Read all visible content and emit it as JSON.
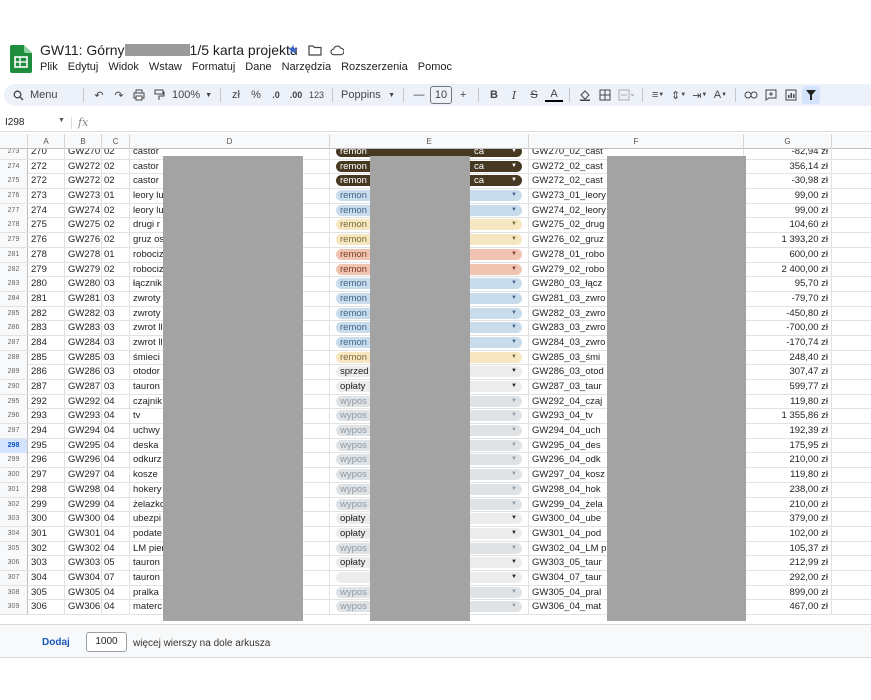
{
  "title": {
    "prefix": "GW11: Górny",
    "suffix": "1/5 karta projektu"
  },
  "menu": [
    "Plik",
    "Edytuj",
    "Widok",
    "Wstaw",
    "Formatuj",
    "Dane",
    "Narzędzia",
    "Rozszerzenia",
    "Pomoc"
  ],
  "toolbar": {
    "search_label": "Menu",
    "zoom": "100%",
    "currency": "zł",
    "percent": "%",
    "dec_decrease": ".0",
    "dec_increase": ".00",
    "number_format": "123",
    "font": "Poppins",
    "font_size": "10",
    "bold": "B",
    "italic": "I",
    "strike": "S",
    "text_color": "A"
  },
  "namebox": "I298",
  "fx": "fx",
  "columns": [
    "A",
    "B",
    "C",
    "D",
    "E",
    "F",
    "G"
  ],
  "colors": {
    "dark": "#473822",
    "blue": "#c9dcec",
    "cream": "#f7e7c0",
    "salmon": "#f1c4b2",
    "light": "#ececec",
    "gray": "#dfe3e6",
    "selected_row": "#d3e3fd"
  },
  "rows": [
    {
      "rn": "273",
      "a": "270",
      "b": "GW270",
      "c": "02",
      "d": "castor",
      "e": "remon",
      "e_tail": "ca",
      "chip": "dark",
      "f": "GW270_02_cast",
      "g": "-82,94 zł"
    },
    {
      "rn": "274",
      "a": "272",
      "b": "GW272",
      "c": "02",
      "d": "castor",
      "e": "remon",
      "e_tail": "ca",
      "chip": "dark",
      "f": "GW272_02_cast",
      "g": "356,14 zł"
    },
    {
      "rn": "275",
      "a": "272",
      "b": "GW272",
      "c": "02",
      "d": "castor",
      "e": "remon",
      "e_tail": "ca",
      "chip": "dark",
      "f": "GW272_02_cast",
      "g": "-30,98 zł"
    },
    {
      "rn": "276",
      "a": "273",
      "b": "GW273",
      "c": "01",
      "d": "leory lu",
      "e": "remon",
      "e_tail": "",
      "chip": "blue",
      "f": "GW273_01_leory",
      "g": "99,00 zł"
    },
    {
      "rn": "277",
      "a": "274",
      "b": "GW274",
      "c": "02",
      "d": "leory lu",
      "e": "remon",
      "e_tail": "",
      "chip": "blue",
      "f": "GW274_02_leory",
      "g": "99,00 zł"
    },
    {
      "rn": "278",
      "a": "275",
      "b": "GW275",
      "c": "02",
      "d": "drugi r",
      "e": "remon",
      "e_tail": "",
      "chip": "cream",
      "f": "GW275_02_drug",
      "g": "104,60 zł"
    },
    {
      "rn": "279",
      "a": "276",
      "b": "GW276",
      "c": "02",
      "d": "gruz os",
      "e": "remon",
      "e_tail": "",
      "chip": "cream",
      "f": "GW276_02_gruz",
      "g": "1 393,20 zł"
    },
    {
      "rn": "281",
      "a": "278",
      "b": "GW278",
      "c": "01",
      "d": "robociz",
      "e": "remon",
      "e_tail": "",
      "chip": "salmon",
      "f": "GW278_01_robo",
      "g": "600,00 zł"
    },
    {
      "rn": "282",
      "a": "279",
      "b": "GW279",
      "c": "02",
      "d": "robociz",
      "e": "remon",
      "e_tail": "",
      "chip": "salmon",
      "f": "GW279_02_robo",
      "g": "2 400,00 zł"
    },
    {
      "rn": "283",
      "a": "280",
      "b": "GW280",
      "c": "03",
      "d": "łącznik",
      "e": "remon",
      "e_tail": "",
      "chip": "blue",
      "f": "GW280_03_łącz",
      "g": "95,70 zł"
    },
    {
      "rn": "284",
      "a": "281",
      "b": "GW281",
      "c": "03",
      "d": "zwroty",
      "e": "remon",
      "e_tail": "",
      "chip": "blue",
      "f": "GW281_03_zwro",
      "g": "-79,70 zł"
    },
    {
      "rn": "285",
      "a": "282",
      "b": "GW282",
      "c": "03",
      "d": "zwroty",
      "e": "remon",
      "e_tail": "",
      "chip": "blue",
      "f": "GW282_03_zwro",
      "g": "-450,80 zł"
    },
    {
      "rn": "286",
      "a": "283",
      "b": "GW283",
      "c": "03",
      "d": "zwrot ll",
      "e": "remon",
      "e_tail": "",
      "chip": "blue",
      "f": "GW283_03_zwro",
      "g": "-700,00 zł"
    },
    {
      "rn": "287",
      "a": "284",
      "b": "GW284",
      "c": "03",
      "d": "zwrot ll",
      "e": "remon",
      "e_tail": "",
      "chip": "blue",
      "f": "GW284_03_zwro",
      "g": "-170,74 zł"
    },
    {
      "rn": "288",
      "a": "285",
      "b": "GW285",
      "c": "03",
      "d": "śmieci",
      "e": "remon",
      "e_tail": "",
      "chip": "cream",
      "f": "GW285_03_śmi",
      "g": "248,40 zł"
    },
    {
      "rn": "289",
      "a": "286",
      "b": "GW286",
      "c": "03",
      "d": "otodor",
      "e": "sprzed",
      "e_tail": "",
      "chip": "light",
      "f": "GW286_03_otod",
      "g": "307,47 zł"
    },
    {
      "rn": "290",
      "a": "287",
      "b": "GW287",
      "c": "03",
      "d": "tauron",
      "e": "opłaty",
      "e_tail": "",
      "chip": "light",
      "f": "GW287_03_taur",
      "g": "599,77 zł"
    },
    {
      "rn": "295",
      "a": "292",
      "b": "GW292",
      "c": "04",
      "d": "czajnik",
      "e": "wypos",
      "e_tail": "",
      "chip": "gray",
      "f": "GW292_04_czaj",
      "g": "119,80 zł"
    },
    {
      "rn": "296",
      "a": "293",
      "b": "GW293",
      "c": "04",
      "d": "tv",
      "e": "wypos",
      "e_tail": "",
      "chip": "gray",
      "f": "GW293_04_tv",
      "g": "1 355,86 zł"
    },
    {
      "rn": "297",
      "a": "294",
      "b": "GW294",
      "c": "04",
      "d": "uchwy",
      "e": "wypos",
      "e_tail": "",
      "chip": "gray",
      "f": "GW294_04_uch",
      "g": "192,39 zł"
    },
    {
      "rn": "298",
      "a": "295",
      "b": "GW295",
      "c": "04",
      "d": "deska",
      "e": "wypos",
      "e_tail": "",
      "chip": "gray",
      "f": "GW295_04_des",
      "g": "175,95 zł",
      "selected": true
    },
    {
      "rn": "299",
      "a": "296",
      "b": "GW296",
      "c": "04",
      "d": "odkurz",
      "e": "wypos",
      "e_tail": "",
      "chip": "gray",
      "f": "GW296_04_odk",
      "g": "210,00 zł"
    },
    {
      "rn": "300",
      "a": "297",
      "b": "GW297",
      "c": "04",
      "d": "kosze",
      "e": "wypos",
      "e_tail": "",
      "chip": "gray",
      "f": "GW297_04_kosz",
      "g": "119,80 zł"
    },
    {
      "rn": "301",
      "a": "298",
      "b": "GW298",
      "c": "04",
      "d": "hokery",
      "e": "wypos",
      "e_tail": "",
      "chip": "gray",
      "f": "GW298_04_hok",
      "g": "238,00 zł"
    },
    {
      "rn": "302",
      "a": "299",
      "b": "GW299",
      "c": "04",
      "d": "żelazko",
      "e": "wypos",
      "e_tail": "",
      "chip": "gray",
      "f": "GW299_04_żela",
      "g": "210,00 zł"
    },
    {
      "rn": "303",
      "a": "300",
      "b": "GW300",
      "c": "04",
      "d": "ubezpi",
      "e": "opłaty",
      "e_tail": "",
      "chip": "light",
      "f": "GW300_04_ube",
      "g": "379,00 zł"
    },
    {
      "rn": "304",
      "a": "301",
      "b": "GW301",
      "c": "04",
      "d": "podate",
      "e": "opłaty",
      "e_tail": "",
      "chip": "light",
      "f": "GW301_04_pod",
      "g": "102,00 zł"
    },
    {
      "rn": "305",
      "a": "302",
      "b": "GW302",
      "c": "04",
      "d": "LM pier",
      "e": "wypos",
      "e_tail": "",
      "chip": "gray",
      "f": "GW302_04_LM p",
      "g": "105,37 zł"
    },
    {
      "rn": "306",
      "a": "303",
      "b": "GW303",
      "c": "05",
      "d": "tauron",
      "e": "opłaty",
      "e_tail": "",
      "chip": "light",
      "f": "GW303_05_taur",
      "g": "212,99 zł"
    },
    {
      "rn": "307",
      "a": "304",
      "b": "GW304",
      "c": "07",
      "d": "tauron",
      "e": "",
      "e_tail": "",
      "chip": "light",
      "f": "GW304_07_taur",
      "g": "292,00 zł"
    },
    {
      "rn": "308",
      "a": "305",
      "b": "GW305",
      "c": "04",
      "d": "pralka",
      "e": "wypos",
      "e_tail": "",
      "chip": "gray",
      "f": "GW305_04_pral",
      "g": "899,00 zł"
    },
    {
      "rn": "309",
      "a": "306",
      "b": "GW306",
      "c": "04",
      "d": "materc",
      "e": "wypos",
      "e_tail": "",
      "chip": "gray",
      "f": "GW306_04_mat",
      "g": "467,00 zł"
    }
  ],
  "footer": {
    "add_label": "Dodaj",
    "rows_value": "1000",
    "more_rows_label": "więcej wierszy na dole arkusza"
  }
}
